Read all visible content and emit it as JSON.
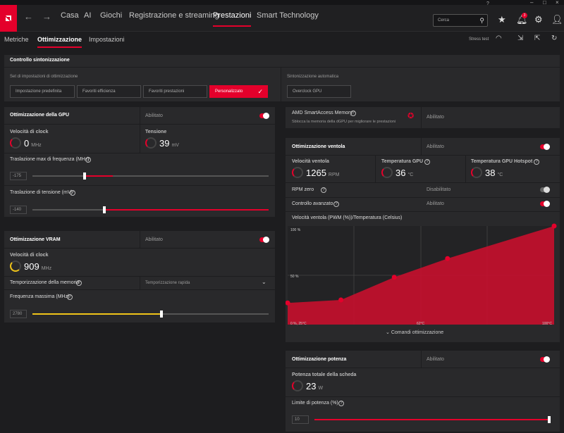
{
  "nav": {
    "items": [
      "Casa",
      "AI",
      "Giochi",
      "Registrazione e streaming",
      "Prestazioni",
      "Smart Technology"
    ],
    "search_placeholder": "Cerca",
    "notif_count": "3"
  },
  "subnav": {
    "items": [
      "Metriche",
      "Ottimizzazione",
      "Impostazioni"
    ],
    "stress_test": "Stress test"
  },
  "tuning": {
    "title": "Controllo sintonizzazione",
    "presets_label": "Set di impostazioni di ottimizzazione",
    "presets": [
      "Impostazione predefinita",
      "Favoriti efficienza",
      "Favoriti prestazioni",
      "Personalizzato"
    ],
    "auto_label": "Sintonizzazione automatica",
    "auto_btn": "Overclock GPU"
  },
  "gpu": {
    "title": "Ottimizzazione della GPU",
    "status": "Abilitato",
    "clock_label": "Velocità di clock",
    "clock_val": "0",
    "clock_unit": "MHz",
    "volt_label": "Tensione",
    "volt_val": "39",
    "volt_unit": "mV",
    "freq_label": "Traslazione max di frequenza (MHz)",
    "freq_val": "-175",
    "freq_pos": 0.28,
    "volt_slider_label": "Traslazione di tensione (mV)",
    "volt_slider_val": "-140",
    "volt_slider_pos": 0.3
  },
  "vram": {
    "title": "Ottimizzazione VRAM",
    "status": "Abilitato",
    "clock_label": "Velocità di clock",
    "clock_val": "909",
    "clock_unit": "MHz",
    "timing_label": "Temporizzazione della memoria",
    "timing_val": "Temporizzazione rapida",
    "maxfreq_label": "Frequenza massima (MHz)",
    "maxfreq_val": "2780",
    "maxfreq_pos": 0.55
  },
  "sam": {
    "title": "AMD SmartAccess Memory",
    "desc": "Sblocca la memoria della dGPU per migliorare le prestazioni",
    "status": "Abilitato"
  },
  "fan": {
    "title": "Ottimizzazione ventola",
    "status": "Abilitato",
    "speed_label": "Velocità ventola",
    "speed_val": "1265",
    "speed_unit": "RPM",
    "gputemp_label": "Temperatura GPU",
    "gputemp_val": "36",
    "gputemp_unit": "°C",
    "hotspot_label": "Temperatura GPU Hotspot",
    "hotspot_val": "38",
    "hotspot_unit": "°C",
    "rpm0_label": "RPM zero",
    "rpm0_status": "Disabilitato",
    "adv_label": "Controllo avanzato",
    "adv_status": "Abilitato",
    "curve_title": "Velocità ventola (PWM (%))/Temperatura (Celsius)",
    "y100": "100 %",
    "y50": "50 %",
    "x0": "0 %, 25°C",
    "x50": "62°C",
    "x100": "100°C",
    "commands": "Comandi ottimizzazione"
  },
  "power": {
    "title": "Ottimizzazione potenza",
    "status": "Abilitato",
    "total_label": "Potenza totale della scheda",
    "total_val": "23",
    "total_unit": "W",
    "limit_label": "Limite di potenza (%)",
    "limit_val": "10",
    "limit_pos": 1.0
  },
  "chart_data": {
    "type": "area",
    "x": [
      25,
      40,
      55,
      70,
      100
    ],
    "y": [
      22,
      25,
      48,
      67,
      100
    ],
    "xlabel": "Temperatura (Celsius)",
    "ylabel": "Velocità ventola (PWM (%))",
    "ylim": [
      0,
      100
    ],
    "xlim": [
      25,
      100
    ]
  }
}
